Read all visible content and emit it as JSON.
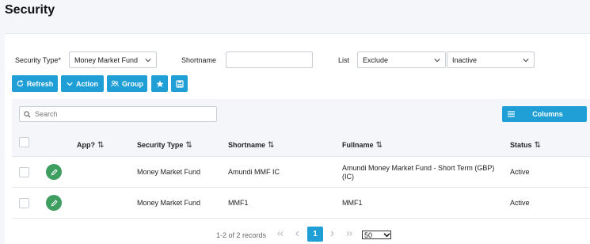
{
  "page": {
    "title": "Security"
  },
  "filters": {
    "security_type_label": "Security Type*",
    "security_type_value": "Money Market Fund",
    "shortname_label": "Shortname",
    "shortname_value": "",
    "list_label": "List",
    "list_value": "Exclude",
    "status_value": "Inactive"
  },
  "toolbar": {
    "refresh_label": "Refresh",
    "action_label": "Action",
    "group_label": "Group"
  },
  "grid": {
    "search_placeholder": "Search",
    "columns_button_label": "Columns",
    "headers": {
      "app": "App?",
      "security_type": "Security Type",
      "shortname": "Shortname",
      "fullname": "Fullname",
      "status": "Status"
    },
    "sort_glyph": "⇅",
    "rows": [
      {
        "security_type": "Money Market Fund",
        "shortname": "Amundi MMF IC",
        "fullname_line1": "Amundi Money Market Fund - Short Term (GBP)",
        "fullname_line2": "(IC)",
        "status": "Active"
      },
      {
        "security_type": "Money Market Fund",
        "shortname": "MMF1",
        "fullname_line1": "MMF1",
        "fullname_line2": "",
        "status": "Active"
      }
    ]
  },
  "pagination": {
    "records_text": "1-2 of 2 records",
    "current_page": "1",
    "page_size": "50"
  },
  "colors": {
    "accent": "#1f9fd6",
    "edit": "#3e9e5f"
  }
}
